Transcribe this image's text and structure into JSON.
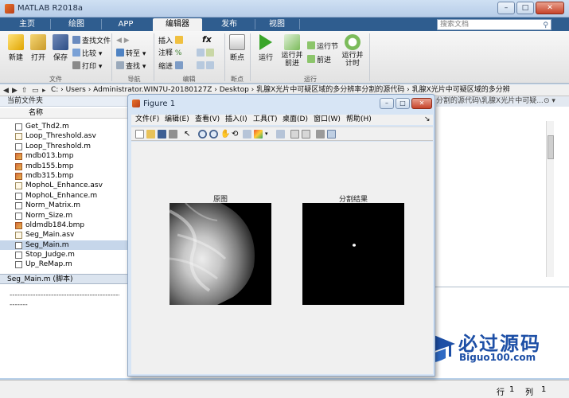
{
  "app": {
    "title": "MATLAB R2018a",
    "tabs": [
      "主页",
      "绘图",
      "APP",
      "编辑器",
      "发布",
      "视图"
    ],
    "active_tab": "编辑器",
    "search_placeholder": "搜索文档"
  },
  "ribbon": {
    "file_group": {
      "label": "文件",
      "new": "新建",
      "open": "打开",
      "save": "保存",
      "find_files": "查找文件",
      "compare": "比较",
      "print": "打印"
    },
    "nav_group": {
      "label": "导航",
      "goto": "转至",
      "find": "查找"
    },
    "edit_group": {
      "label": "编辑",
      "insert": "插入",
      "comment": "注释",
      "indent": "缩进",
      "fx": "fx"
    },
    "breakpoints_group": {
      "label": "断点",
      "breakpoints": "断点"
    },
    "run_group": {
      "label": "运行",
      "run": "运行",
      "run_and_advance": "运行并\n前进",
      "run_section": "运行节",
      "advance": "前进",
      "run_and_time": "运行并\n计时"
    }
  },
  "address": {
    "path": "C: › Users › Administrator.WIN7U-20180127Z › Desktop › 乳腺X光片中可疑区域的多分辨率分割的源代码 › 乳腺X光片中可疑区域的多分辨"
  },
  "folder_panel": {
    "title": "当前文件夹",
    "column_name": "名称",
    "files": [
      {
        "name": "Get_Thd2.m",
        "type": "m"
      },
      {
        "name": "Loop_Threshold.asv",
        "type": "asv"
      },
      {
        "name": "Loop_Threshold.m",
        "type": "m"
      },
      {
        "name": "mdb013.bmp",
        "type": "bmp"
      },
      {
        "name": "mdb155.bmp",
        "type": "bmp"
      },
      {
        "name": "mdb315.bmp",
        "type": "bmp"
      },
      {
        "name": "MophoL_Enhance.asv",
        "type": "asv"
      },
      {
        "name": "MophoL_Enhance.m",
        "type": "m"
      },
      {
        "name": "Norm_Matrix.m",
        "type": "m"
      },
      {
        "name": "Norm_Size.m",
        "type": "m"
      },
      {
        "name": "oldmdb184.bmp",
        "type": "bmp"
      },
      {
        "name": "Seg_Main.asv",
        "type": "asv"
      },
      {
        "name": "Seg_Main.m",
        "type": "m",
        "selected": true
      },
      {
        "name": "Stop_Judge.m",
        "type": "m"
      },
      {
        "name": "Up_ReMap.m",
        "type": "m"
      }
    ]
  },
  "details": {
    "header": "Seg_Main.m  (脚本)",
    "line1": "------------------------------------------------",
    "line2": "-------"
  },
  "editor": {
    "tab_text": "分割的源代码\\乳腺X光片中可疑...",
    "controls": "⊙ ▾"
  },
  "status": {
    "row_label": "行",
    "row_value": "1",
    "col_label": "列",
    "col_value": "1"
  },
  "watermark": {
    "text": "必过源码",
    "url": "Biguo100.com"
  },
  "figure": {
    "title": "Figure 1",
    "menu": [
      "文件(F)",
      "编辑(E)",
      "查看(V)",
      "插入(I)",
      "工具(T)",
      "桌面(D)",
      "窗口(W)",
      "帮助(H)"
    ],
    "left_axes_title": "原图",
    "right_axes_title": "分割结果"
  },
  "colors": {
    "tab_bar": "#2f5d8f",
    "active_tab": "#f2f2f2",
    "selection": "#c6d6ea",
    "figure_frame": "#d7e5f5"
  }
}
